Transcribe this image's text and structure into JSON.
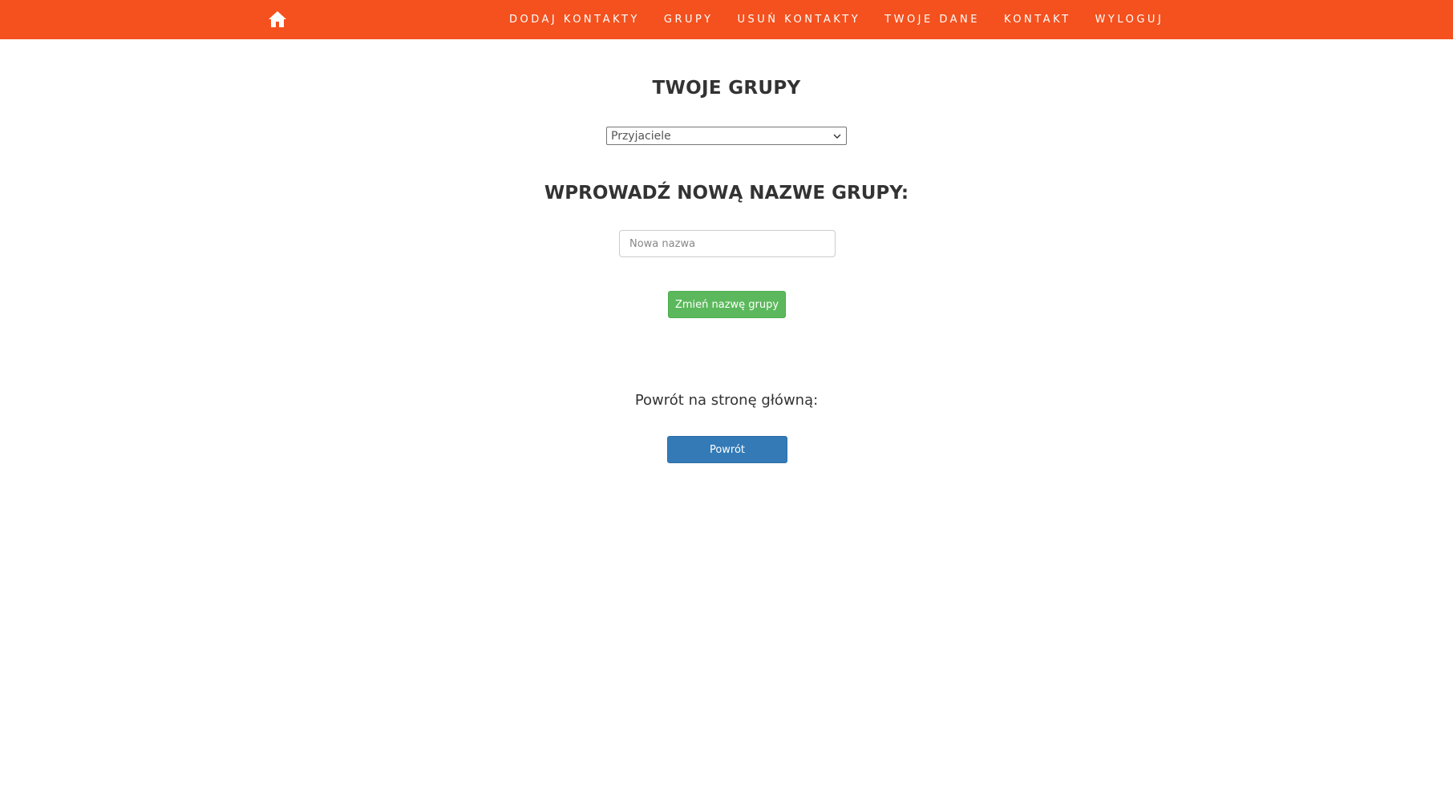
{
  "nav": {
    "home_icon": "home-icon",
    "items": [
      {
        "label": "DODAJ KONTAKTY"
      },
      {
        "label": "GRUPY"
      },
      {
        "label": "USUŃ KONTAKTY"
      },
      {
        "label": "TWOJE DANE"
      },
      {
        "label": "KONTAKT"
      },
      {
        "label": "WYLOGUJ"
      }
    ]
  },
  "main": {
    "title": "TWOJE GRUPY",
    "group_select": {
      "selected": "Przyjaciele"
    },
    "subtitle": "WPROWADŹ NOWĄ NAZWE GRUPY:",
    "new_name_input": {
      "value": "",
      "placeholder": "Nowa nazwa"
    },
    "rename_button": "Zmień nazwę grupy",
    "back_label": "Powrót na stronę główną:",
    "back_button": "Powrót"
  },
  "colors": {
    "navbar": "#f4511e",
    "rename_button": "#5cb85c",
    "back_button": "#337ab7"
  }
}
